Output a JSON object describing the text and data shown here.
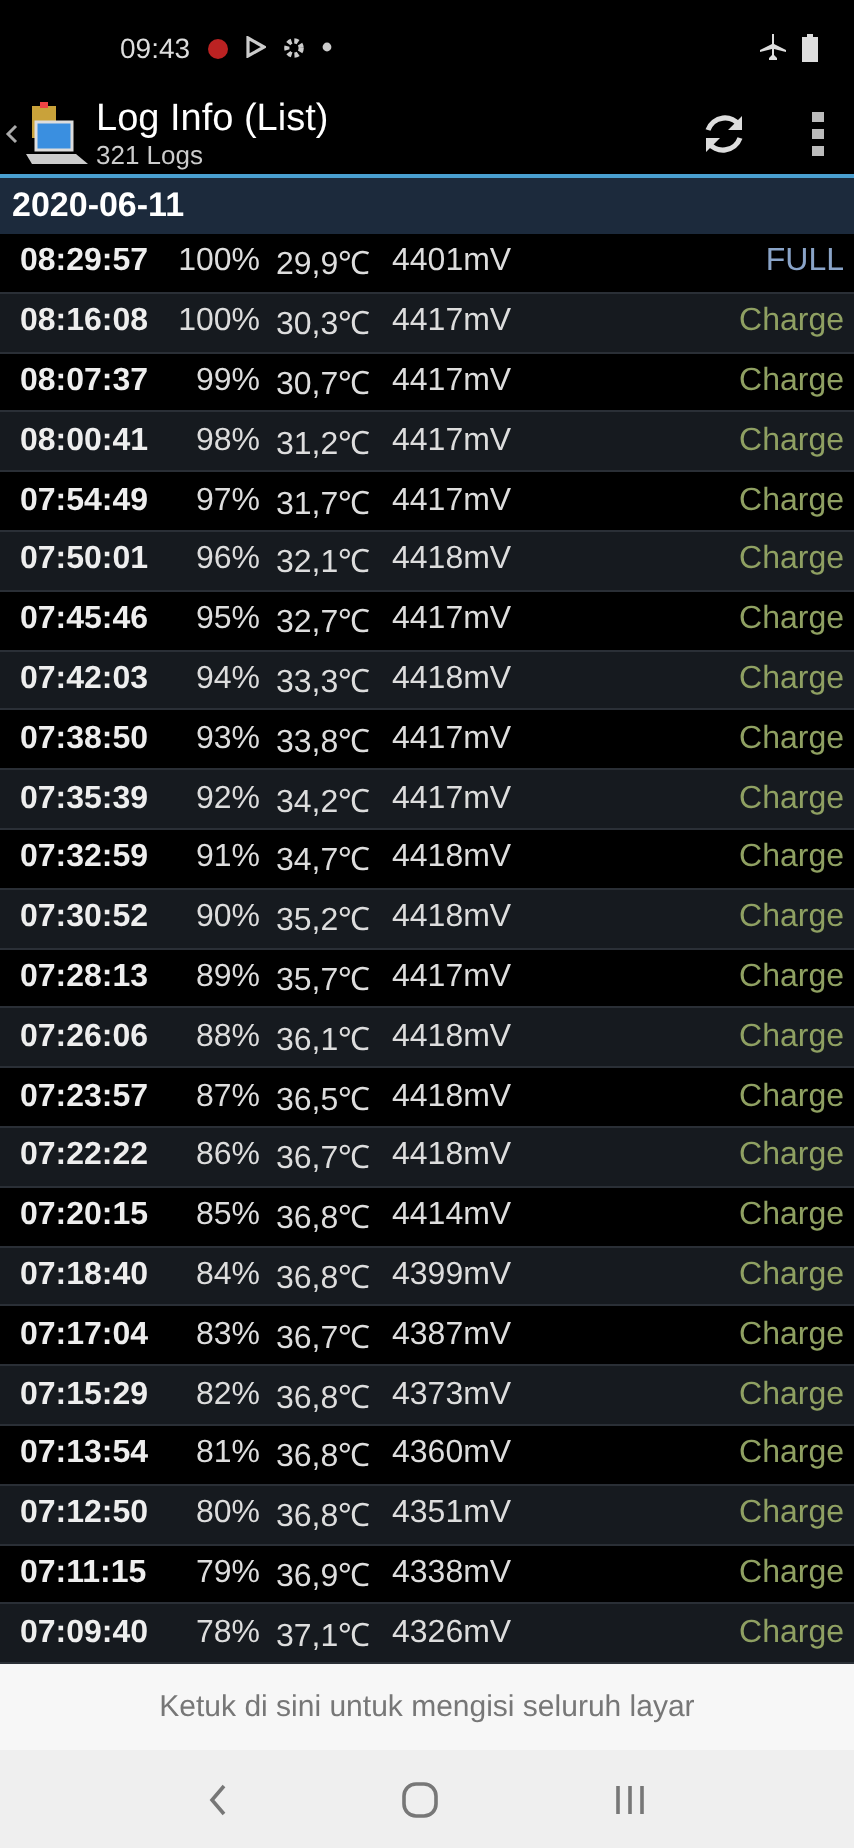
{
  "status_bar": {
    "time": "09:43"
  },
  "app_bar": {
    "title": "Log Info (List)",
    "subtitle": "321 Logs"
  },
  "date_header": "2020-06-11",
  "logs": [
    {
      "time": "08:29:57",
      "percent": "100%",
      "temperature": "29,9℃",
      "voltage": "4401mV",
      "status": "FULL",
      "kind": "full"
    },
    {
      "time": "08:16:08",
      "percent": "100%",
      "temperature": "30,3℃",
      "voltage": "4417mV",
      "status": "Charge",
      "kind": "charge"
    },
    {
      "time": "08:07:37",
      "percent": "99%",
      "temperature": "30,7℃",
      "voltage": "4417mV",
      "status": "Charge",
      "kind": "charge"
    },
    {
      "time": "08:00:41",
      "percent": "98%",
      "temperature": "31,2℃",
      "voltage": "4417mV",
      "status": "Charge",
      "kind": "charge"
    },
    {
      "time": "07:54:49",
      "percent": "97%",
      "temperature": "31,7℃",
      "voltage": "4417mV",
      "status": "Charge",
      "kind": "charge"
    },
    {
      "time": "07:50:01",
      "percent": "96%",
      "temperature": "32,1℃",
      "voltage": "4418mV",
      "status": "Charge",
      "kind": "charge"
    },
    {
      "time": "07:45:46",
      "percent": "95%",
      "temperature": "32,7℃",
      "voltage": "4417mV",
      "status": "Charge",
      "kind": "charge"
    },
    {
      "time": "07:42:03",
      "percent": "94%",
      "temperature": "33,3℃",
      "voltage": "4418mV",
      "status": "Charge",
      "kind": "charge"
    },
    {
      "time": "07:38:50",
      "percent": "93%",
      "temperature": "33,8℃",
      "voltage": "4417mV",
      "status": "Charge",
      "kind": "charge"
    },
    {
      "time": "07:35:39",
      "percent": "92%",
      "temperature": "34,2℃",
      "voltage": "4417mV",
      "status": "Charge",
      "kind": "charge"
    },
    {
      "time": "07:32:59",
      "percent": "91%",
      "temperature": "34,7℃",
      "voltage": "4418mV",
      "status": "Charge",
      "kind": "charge"
    },
    {
      "time": "07:30:52",
      "percent": "90%",
      "temperature": "35,2℃",
      "voltage": "4418mV",
      "status": "Charge",
      "kind": "charge"
    },
    {
      "time": "07:28:13",
      "percent": "89%",
      "temperature": "35,7℃",
      "voltage": "4417mV",
      "status": "Charge",
      "kind": "charge"
    },
    {
      "time": "07:26:06",
      "percent": "88%",
      "temperature": "36,1℃",
      "voltage": "4418mV",
      "status": "Charge",
      "kind": "charge"
    },
    {
      "time": "07:23:57",
      "percent": "87%",
      "temperature": "36,5℃",
      "voltage": "4418mV",
      "status": "Charge",
      "kind": "charge"
    },
    {
      "time": "07:22:22",
      "percent": "86%",
      "temperature": "36,7℃",
      "voltage": "4418mV",
      "status": "Charge",
      "kind": "charge"
    },
    {
      "time": "07:20:15",
      "percent": "85%",
      "temperature": "36,8℃",
      "voltage": "4414mV",
      "status": "Charge",
      "kind": "charge"
    },
    {
      "time": "07:18:40",
      "percent": "84%",
      "temperature": "36,8℃",
      "voltage": "4399mV",
      "status": "Charge",
      "kind": "charge"
    },
    {
      "time": "07:17:04",
      "percent": "83%",
      "temperature": "36,7℃",
      "voltage": "4387mV",
      "status": "Charge",
      "kind": "charge"
    },
    {
      "time": "07:15:29",
      "percent": "82%",
      "temperature": "36,8℃",
      "voltage": "4373mV",
      "status": "Charge",
      "kind": "charge"
    },
    {
      "time": "07:13:54",
      "percent": "81%",
      "temperature": "36,8℃",
      "voltage": "4360mV",
      "status": "Charge",
      "kind": "charge"
    },
    {
      "time": "07:12:50",
      "percent": "80%",
      "temperature": "36,8℃",
      "voltage": "4351mV",
      "status": "Charge",
      "kind": "charge"
    },
    {
      "time": "07:11:15",
      "percent": "79%",
      "temperature": "36,9℃",
      "voltage": "4338mV",
      "status": "Charge",
      "kind": "charge"
    },
    {
      "time": "07:09:40",
      "percent": "78%",
      "temperature": "37,1℃",
      "voltage": "4326mV",
      "status": "Charge",
      "kind": "charge"
    }
  ],
  "banner": "Ketuk di sini untuk mengisi seluruh layar"
}
